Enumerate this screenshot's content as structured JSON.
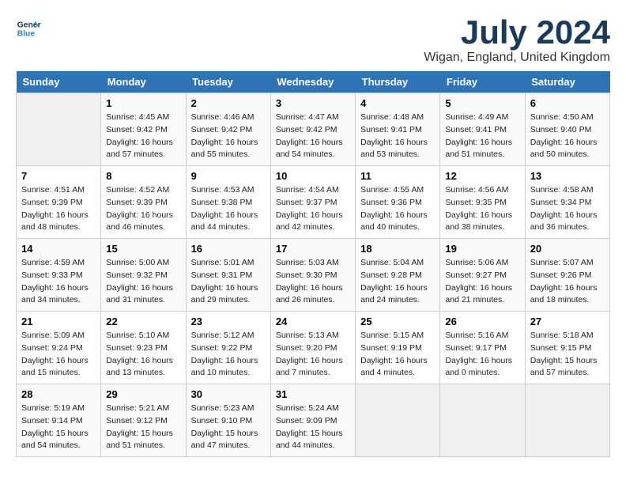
{
  "header": {
    "logo_line1": "General",
    "logo_line2": "Blue",
    "month_title": "July 2024",
    "location": "Wigan, England, United Kingdom"
  },
  "weekdays": [
    "Sunday",
    "Monday",
    "Tuesday",
    "Wednesday",
    "Thursday",
    "Friday",
    "Saturday"
  ],
  "weeks": [
    [
      {
        "day": "",
        "sunrise": "",
        "sunset": "",
        "daylight": ""
      },
      {
        "day": "1",
        "sunrise": "4:45 AM",
        "sunset": "9:42 PM",
        "daylight": "16 hours and 57 minutes."
      },
      {
        "day": "2",
        "sunrise": "4:46 AM",
        "sunset": "9:42 PM",
        "daylight": "16 hours and 55 minutes."
      },
      {
        "day": "3",
        "sunrise": "4:47 AM",
        "sunset": "9:42 PM",
        "daylight": "16 hours and 54 minutes."
      },
      {
        "day": "4",
        "sunrise": "4:48 AM",
        "sunset": "9:41 PM",
        "daylight": "16 hours and 53 minutes."
      },
      {
        "day": "5",
        "sunrise": "4:49 AM",
        "sunset": "9:41 PM",
        "daylight": "16 hours and 51 minutes."
      },
      {
        "day": "6",
        "sunrise": "4:50 AM",
        "sunset": "9:40 PM",
        "daylight": "16 hours and 50 minutes."
      }
    ],
    [
      {
        "day": "7",
        "sunrise": "4:51 AM",
        "sunset": "9:39 PM",
        "daylight": "16 hours and 48 minutes."
      },
      {
        "day": "8",
        "sunrise": "4:52 AM",
        "sunset": "9:39 PM",
        "daylight": "16 hours and 46 minutes."
      },
      {
        "day": "9",
        "sunrise": "4:53 AM",
        "sunset": "9:38 PM",
        "daylight": "16 hours and 44 minutes."
      },
      {
        "day": "10",
        "sunrise": "4:54 AM",
        "sunset": "9:37 PM",
        "daylight": "16 hours and 42 minutes."
      },
      {
        "day": "11",
        "sunrise": "4:55 AM",
        "sunset": "9:36 PM",
        "daylight": "16 hours and 40 minutes."
      },
      {
        "day": "12",
        "sunrise": "4:56 AM",
        "sunset": "9:35 PM",
        "daylight": "16 hours and 38 minutes."
      },
      {
        "day": "13",
        "sunrise": "4:58 AM",
        "sunset": "9:34 PM",
        "daylight": "16 hours and 36 minutes."
      }
    ],
    [
      {
        "day": "14",
        "sunrise": "4:59 AM",
        "sunset": "9:33 PM",
        "daylight": "16 hours and 34 minutes."
      },
      {
        "day": "15",
        "sunrise": "5:00 AM",
        "sunset": "9:32 PM",
        "daylight": "16 hours and 31 minutes."
      },
      {
        "day": "16",
        "sunrise": "5:01 AM",
        "sunset": "9:31 PM",
        "daylight": "16 hours and 29 minutes."
      },
      {
        "day": "17",
        "sunrise": "5:03 AM",
        "sunset": "9:30 PM",
        "daylight": "16 hours and 26 minutes."
      },
      {
        "day": "18",
        "sunrise": "5:04 AM",
        "sunset": "9:28 PM",
        "daylight": "16 hours and 24 minutes."
      },
      {
        "day": "19",
        "sunrise": "5:06 AM",
        "sunset": "9:27 PM",
        "daylight": "16 hours and 21 minutes."
      },
      {
        "day": "20",
        "sunrise": "5:07 AM",
        "sunset": "9:26 PM",
        "daylight": "16 hours and 18 minutes."
      }
    ],
    [
      {
        "day": "21",
        "sunrise": "5:09 AM",
        "sunset": "9:24 PM",
        "daylight": "16 hours and 15 minutes."
      },
      {
        "day": "22",
        "sunrise": "5:10 AM",
        "sunset": "9:23 PM",
        "daylight": "16 hours and 13 minutes."
      },
      {
        "day": "23",
        "sunrise": "5:12 AM",
        "sunset": "9:22 PM",
        "daylight": "16 hours and 10 minutes."
      },
      {
        "day": "24",
        "sunrise": "5:13 AM",
        "sunset": "9:20 PM",
        "daylight": "16 hours and 7 minutes."
      },
      {
        "day": "25",
        "sunrise": "5:15 AM",
        "sunset": "9:19 PM",
        "daylight": "16 hours and 4 minutes."
      },
      {
        "day": "26",
        "sunrise": "5:16 AM",
        "sunset": "9:17 PM",
        "daylight": "16 hours and 0 minutes."
      },
      {
        "day": "27",
        "sunrise": "5:18 AM",
        "sunset": "9:15 PM",
        "daylight": "15 hours and 57 minutes."
      }
    ],
    [
      {
        "day": "28",
        "sunrise": "5:19 AM",
        "sunset": "9:14 PM",
        "daylight": "15 hours and 54 minutes."
      },
      {
        "day": "29",
        "sunrise": "5:21 AM",
        "sunset": "9:12 PM",
        "daylight": "15 hours and 51 minutes."
      },
      {
        "day": "30",
        "sunrise": "5:23 AM",
        "sunset": "9:10 PM",
        "daylight": "15 hours and 47 minutes."
      },
      {
        "day": "31",
        "sunrise": "5:24 AM",
        "sunset": "9:09 PM",
        "daylight": "15 hours and 44 minutes."
      },
      {
        "day": "",
        "sunrise": "",
        "sunset": "",
        "daylight": ""
      },
      {
        "day": "",
        "sunrise": "",
        "sunset": "",
        "daylight": ""
      },
      {
        "day": "",
        "sunrise": "",
        "sunset": "",
        "daylight": ""
      }
    ]
  ]
}
